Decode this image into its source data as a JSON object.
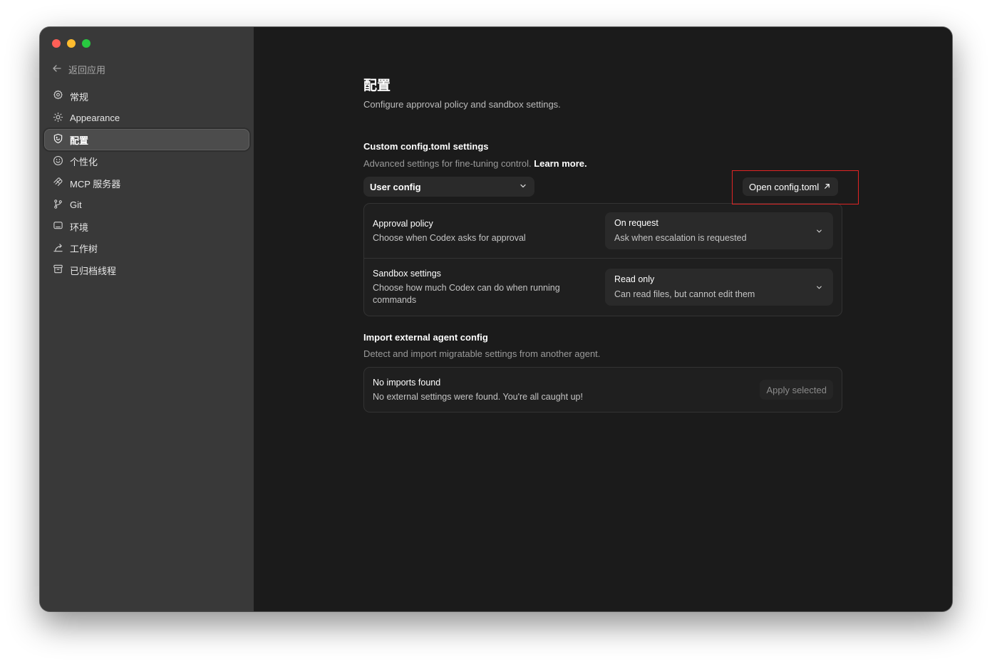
{
  "sidebar": {
    "back_label": "返回应用",
    "items": [
      {
        "label": "常规",
        "icon": "gear-icon"
      },
      {
        "label": "Appearance",
        "icon": "sun-icon"
      },
      {
        "label": "配置",
        "icon": "shield-icon",
        "active": true
      },
      {
        "label": "个性化",
        "icon": "smile-icon"
      },
      {
        "label": "MCP 服务器",
        "icon": "mcp-icon"
      },
      {
        "label": "Git",
        "icon": "git-branch-icon"
      },
      {
        "label": "环境",
        "icon": "monitor-icon"
      },
      {
        "label": "工作树",
        "icon": "worktree-icon"
      },
      {
        "label": "已归档线程",
        "icon": "archive-icon"
      }
    ]
  },
  "main": {
    "title": "配置",
    "subtitle": "Configure approval policy and sandbox settings.",
    "custom_config": {
      "title": "Custom config.toml settings",
      "desc": "Advanced settings for fine-tuning control.",
      "learn_more": "Learn more.",
      "scope_select": "User config",
      "open_button": "Open config.toml",
      "rows": [
        {
          "title": "Approval policy",
          "desc": "Choose when Codex asks for approval",
          "value": "On request",
          "value_desc": "Ask when escalation is requested"
        },
        {
          "title": "Sandbox settings",
          "desc": "Choose how much Codex can do when running commands",
          "value": "Read only",
          "value_desc": "Can read files, but cannot edit them"
        }
      ]
    },
    "import_config": {
      "title": "Import external agent config",
      "desc": "Detect and import migratable settings from another agent.",
      "status_title": "No imports found",
      "status_desc": "No external settings were found. You're all caught up!",
      "apply_button": "Apply selected"
    }
  },
  "colors": {
    "sidebar_bg": "#393939",
    "main_bg": "#1b1b1b",
    "highlight": "#e02424",
    "traffic_red": "#fe5f57",
    "traffic_yellow": "#febc2e",
    "traffic_green": "#28c840"
  }
}
